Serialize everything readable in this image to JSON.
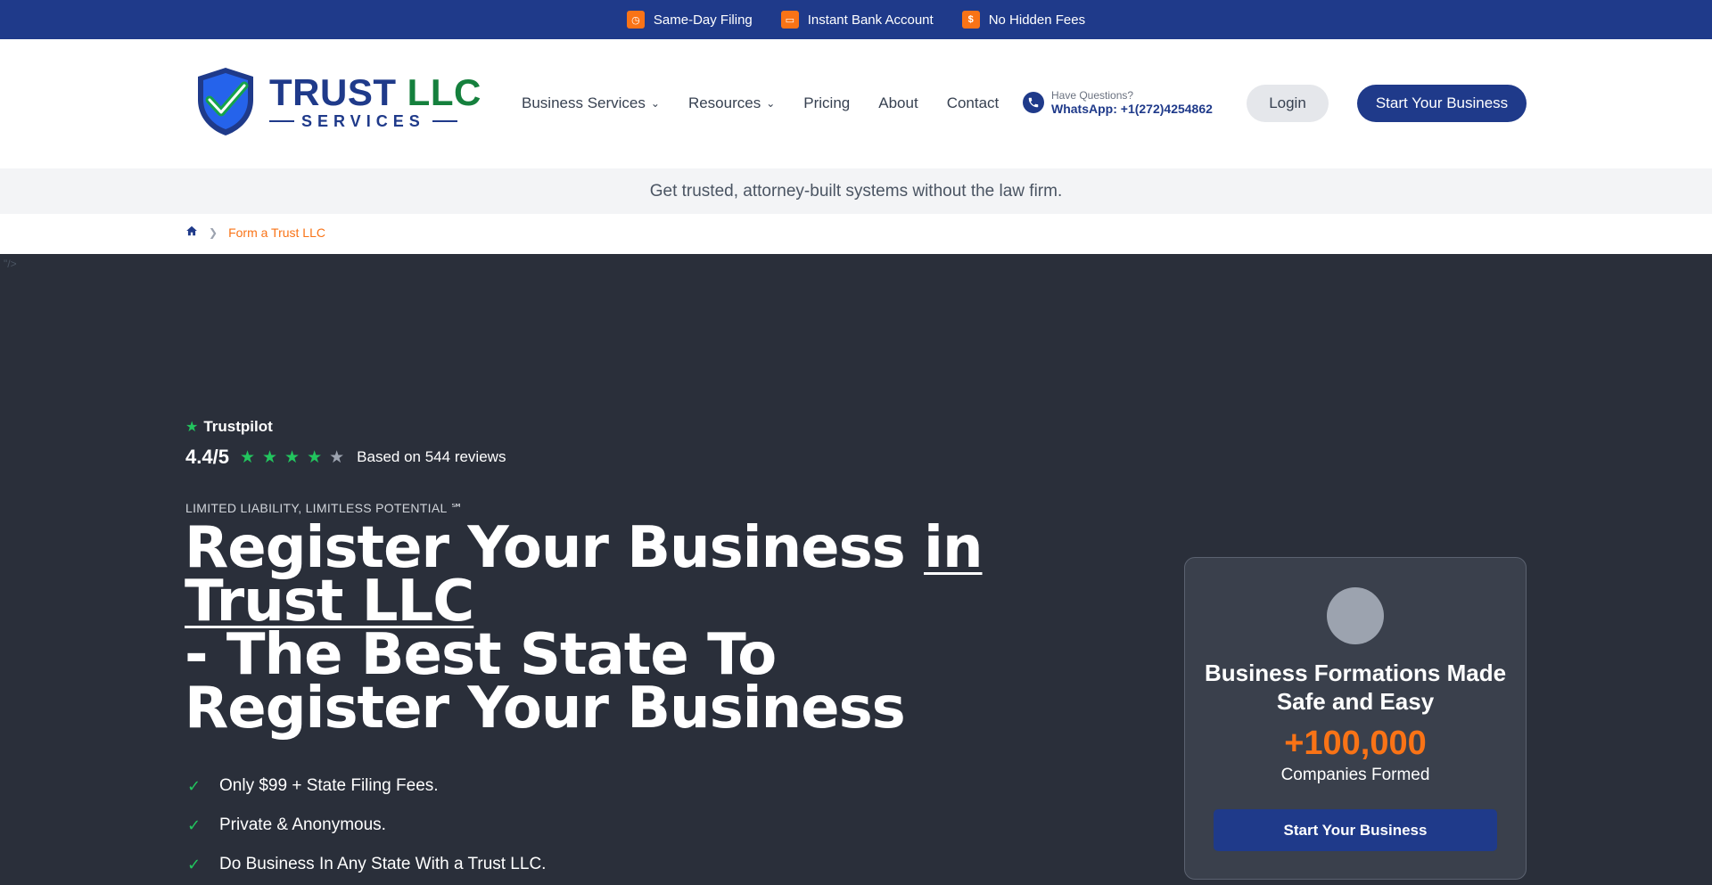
{
  "topbar": {
    "items": [
      {
        "label": "Same-Day Filing",
        "icon": "clock-icon"
      },
      {
        "label": "Instant Bank Account",
        "icon": "bank-card-icon"
      },
      {
        "label": "No Hidden Fees",
        "icon": "dollar-icon"
      }
    ],
    "accent": "#f97316",
    "background": "#1f3a8a"
  },
  "header": {
    "logo": {
      "main": "TRUST",
      "llc": "LLC",
      "sub": "SERVICES"
    },
    "nav": [
      {
        "label": "Business Services",
        "has_dropdown": true
      },
      {
        "label": "Resources",
        "has_dropdown": true
      },
      {
        "label": "Pricing",
        "has_dropdown": false
      },
      {
        "label": "About",
        "has_dropdown": false
      },
      {
        "label": "Contact",
        "has_dropdown": false
      }
    ],
    "contact": {
      "label": "Have Questions?",
      "phone": "WhatsApp: +1(272)4254862"
    },
    "login_label": "Login",
    "start_label": "Start Your Business"
  },
  "tagline": "Get trusted, attorney-built systems without the law firm.",
  "breadcrumb": {
    "current": "Form a Trust LLC"
  },
  "hero": {
    "stray_text": "\"/>",
    "trustpilot": "Trustpilot",
    "rating": "4.4/5",
    "stars_filled": 4,
    "stars_total": 5,
    "reviews": "Based on 544 reviews",
    "eyebrow": "LIMITED LIABILITY, LIMITLESS POTENTIAL ℠",
    "headline_part1": "Register Your Business ",
    "headline_underlined": "in Trust LLC",
    "headline_part2": "- The Best State To Register Your Business",
    "benefits": [
      "Only $99 + State Filing Fees.",
      "Private & Anonymous.",
      "Do Business In Any State With a Trust LLC."
    ]
  },
  "card": {
    "title": "Business Formations Made Safe and Easy",
    "count": "+100,000",
    "subtitle": "Companies Formed",
    "button": "Start Your Business"
  }
}
